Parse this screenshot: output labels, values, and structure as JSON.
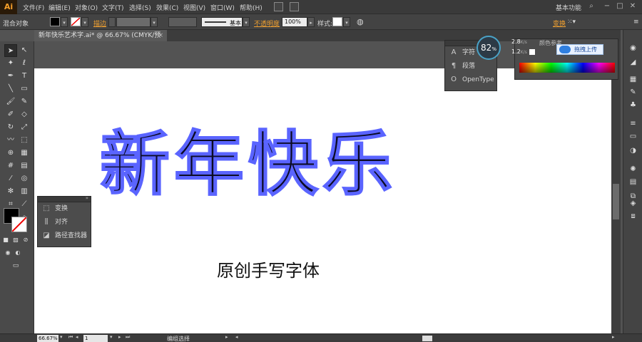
{
  "app": {
    "logo": "Ai",
    "workspace": "基本功能"
  },
  "menu": [
    "文件(F)",
    "编辑(E)",
    "对象(O)",
    "文字(T)",
    "选择(S)",
    "效果(C)",
    "视图(V)",
    "窗口(W)",
    "帮助(H)"
  ],
  "control": {
    "selection_label": "混合对象",
    "stroke_label": "描边",
    "style_label": "基本",
    "opacity_label": "不透明度",
    "opacity_value": "100%",
    "style2_label": "样式:",
    "transform_label": "变换"
  },
  "document": {
    "tab_title": "新年快乐艺术字.ai* @ 66.67% (CMYK/预览)",
    "close": "×"
  },
  "artboard": {
    "headline": "新年快乐",
    "subtitle": "原创手写字体"
  },
  "panels": {
    "transform_group": [
      {
        "label": "变换",
        "icon": "transform-icon"
      },
      {
        "label": "对齐",
        "icon": "align-icon"
      },
      {
        "label": "路径查找器",
        "icon": "pathfinder-icon"
      }
    ],
    "type_group": [
      {
        "label": "字符",
        "icon": "character-icon"
      },
      {
        "label": "段落",
        "icon": "paragraph-icon"
      },
      {
        "label": "OpenType",
        "icon": "opentype-icon"
      }
    ],
    "color_tab": "颜色参考"
  },
  "overlay": {
    "speed_percent": "82",
    "speed_unit": "%",
    "up_rate": "2.8",
    "up_unit": "K/s",
    "down_rate": "1.2",
    "down_unit": "K/s",
    "upload_label": "拖拽上传"
  },
  "status": {
    "zoom": "66.67%",
    "page": "1",
    "mode": "编组选择"
  }
}
